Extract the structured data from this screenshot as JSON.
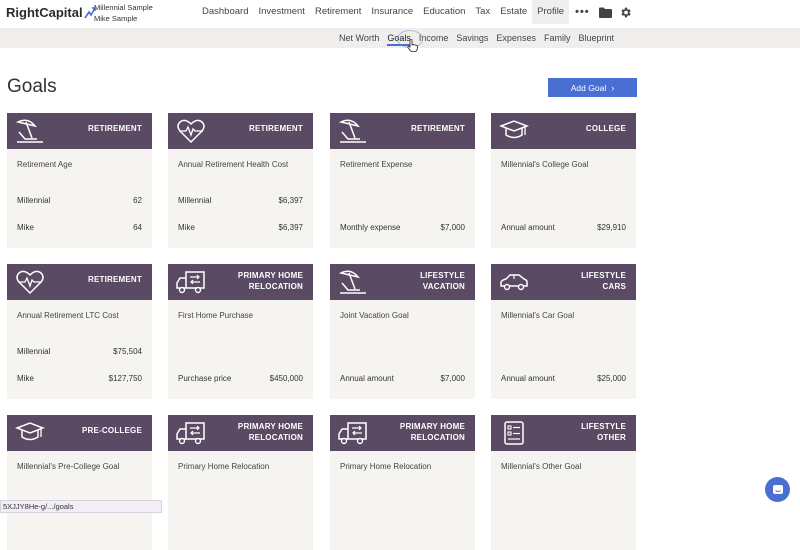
{
  "brand": {
    "name": "RightCapital"
  },
  "client": {
    "primary": "Millennial Sample",
    "secondary": "Mike Sample"
  },
  "main_nav": [
    {
      "label": "Dashboard"
    },
    {
      "label": "Investment"
    },
    {
      "label": "Retirement"
    },
    {
      "label": "Insurance"
    },
    {
      "label": "Education"
    },
    {
      "label": "Tax"
    },
    {
      "label": "Estate"
    },
    {
      "label": "Profile",
      "active": true
    }
  ],
  "nav_more": "•••",
  "sub_nav": [
    {
      "label": "Net Worth"
    },
    {
      "label": "Goals",
      "active": true
    },
    {
      "label": "Income"
    },
    {
      "label": "Savings"
    },
    {
      "label": "Expenses"
    },
    {
      "label": "Family"
    },
    {
      "label": "Blueprint"
    }
  ],
  "page": {
    "title": "Goals",
    "add_button": "Add Goal"
  },
  "cards": [
    {
      "icon": "beach-chair-icon",
      "category": [
        "RETIREMENT"
      ],
      "name": "Retirement Age",
      "rows": [
        {
          "label": "Millennial",
          "value": "62"
        },
        {
          "label": "Mike",
          "value": "64"
        }
      ]
    },
    {
      "icon": "heart-pulse-icon",
      "category": [
        "RETIREMENT"
      ],
      "name": "Annual Retirement Health Cost",
      "rows": [
        {
          "label": "Millennial",
          "value": "$6,397"
        },
        {
          "label": "Mike",
          "value": "$6,397"
        }
      ]
    },
    {
      "icon": "beach-chair-icon",
      "category": [
        "RETIREMENT"
      ],
      "name": "Retirement Expense",
      "rows": [
        {
          "label": "",
          "value": ""
        },
        {
          "label": "Monthly expense",
          "value": "$7,000"
        }
      ]
    },
    {
      "icon": "graduation-cap-icon",
      "category": [
        "COLLEGE"
      ],
      "name": "Millennial's College Goal",
      "rows": [
        {
          "label": "",
          "value": ""
        },
        {
          "label": "Annual amount",
          "value": "$29,910"
        }
      ]
    },
    {
      "icon": "heart-pulse-icon",
      "category": [
        "RETIREMENT"
      ],
      "name": "Annual Retirement LTC Cost",
      "rows": [
        {
          "label": "Millennial",
          "value": "$75,504"
        },
        {
          "label": "Mike",
          "value": "$127,750"
        }
      ]
    },
    {
      "icon": "moving-truck-icon",
      "category": [
        "PRIMARY HOME",
        "RELOCATION"
      ],
      "name": "First Home Purchase",
      "rows": [
        {
          "label": "",
          "value": ""
        },
        {
          "label": "Purchase price",
          "value": "$450,000"
        }
      ]
    },
    {
      "icon": "beach-chair-icon",
      "category": [
        "LIFESTYLE",
        "VACATION"
      ],
      "name": "Joint Vacation Goal",
      "rows": [
        {
          "label": "",
          "value": ""
        },
        {
          "label": "Annual amount",
          "value": "$7,000"
        }
      ]
    },
    {
      "icon": "car-icon",
      "category": [
        "LIFESTYLE",
        "CARS"
      ],
      "name": "Millennial's Car Goal",
      "rows": [
        {
          "label": "",
          "value": ""
        },
        {
          "label": "Annual amount",
          "value": "$25,000"
        }
      ]
    },
    {
      "icon": "graduation-cap-icon",
      "category": [
        "PRE-COLLEGE"
      ],
      "name": "Millennial's Pre-College Goal",
      "rows": [
        {
          "label": "",
          "value": ""
        },
        {
          "label": "",
          "value": ""
        }
      ]
    },
    {
      "icon": "moving-truck-icon",
      "category": [
        "PRIMARY HOME",
        "RELOCATION"
      ],
      "name": "Primary Home Relocation",
      "rows": [
        {
          "label": "",
          "value": ""
        },
        {
          "label": "",
          "value": ""
        }
      ]
    },
    {
      "icon": "moving-truck-icon",
      "category": [
        "PRIMARY HOME",
        "RELOCATION"
      ],
      "name": "Primary Home Relocation",
      "rows": [
        {
          "label": "",
          "value": ""
        },
        {
          "label": "",
          "value": ""
        }
      ]
    },
    {
      "icon": "checklist-icon",
      "category": [
        "LIFESTYLE",
        "OTHER"
      ],
      "name": "Millennial's Other Goal",
      "rows": [
        {
          "label": "",
          "value": ""
        },
        {
          "label": "",
          "value": ""
        }
      ]
    }
  ],
  "status_url": "5XJJY8He-g/.../goals",
  "colors": {
    "accent": "#4a6fd3",
    "card_header": "#5b4a63",
    "card_body": "#f6f4f0",
    "subnav_bg": "#efeeed"
  }
}
